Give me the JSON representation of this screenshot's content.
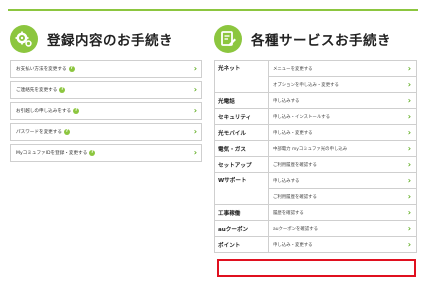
{
  "colors": {
    "accent": "#8cc63f",
    "chevron": "#5cab1c",
    "highlight": "#e0101f"
  },
  "left": {
    "title": "登録内容のお手続き",
    "icon": "gear-icon",
    "items": [
      {
        "label": "お支払い方法を変更する",
        "help": "?"
      },
      {
        "label": "ご連絡先を変更する",
        "help": "?"
      },
      {
        "label": "お引越しの申し込みをする",
        "help": "?"
      },
      {
        "label": "パスワードを変更する",
        "help": "?"
      },
      {
        "label": "MyコミュファIDを登録・変更する",
        "help": "?"
      }
    ]
  },
  "right": {
    "title": "各種サービスお手続き",
    "icon": "pencil-document-icon",
    "services": [
      {
        "category": "光ネット",
        "actions": [
          "メニューを変更する",
          "オプションを申し込み・変更する"
        ]
      },
      {
        "category": "光電話",
        "actions": [
          "申し込みする"
        ]
      },
      {
        "category": "セキュリティ",
        "actions": [
          "申し込み・インストールする"
        ]
      },
      {
        "category": "光モバイル",
        "actions": [
          "申し込み・変更する"
        ]
      },
      {
        "category": "電気・ガス",
        "actions": [
          "中部電力 myコミュファ光の申し込み"
        ]
      },
      {
        "category": "セットアップ",
        "actions": [
          "ご利用履歴を確認する"
        ]
      },
      {
        "category": "Wサポート",
        "actions": [
          "申し込みする",
          "ご利用履歴を確認する"
        ]
      },
      {
        "category": "工事稼働",
        "actions": [
          "履歴を確認する"
        ]
      },
      {
        "category": "auクーポン",
        "actions": [
          "auクーポンを確認する"
        ]
      },
      {
        "category": "ポイント",
        "actions": [
          "申し込み・変更する"
        ]
      }
    ],
    "chevron": "›"
  }
}
